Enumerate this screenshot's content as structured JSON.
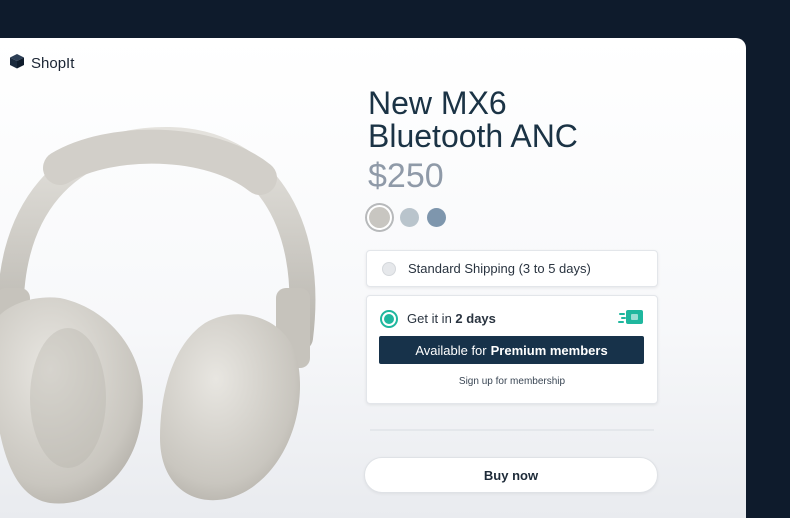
{
  "brand": {
    "name": "ShopIt",
    "icon": "cube-icon"
  },
  "product": {
    "title_line1": "New MX6",
    "title_line2": "Bluetooth ANC",
    "price": "$250",
    "colors": [
      "#c8c6c1",
      "#b9c4cc",
      "#7e96ad"
    ],
    "selected_color": 0
  },
  "shipping": {
    "standard": {
      "label": "Standard Shipping (3 to 5 days)",
      "selected": false
    },
    "express": {
      "label_prefix": "Get it in",
      "label_bold": "2 days",
      "selected": true,
      "icon": "fast-truck-icon",
      "premium_prefix": "Available for",
      "premium_bold": "Premium members",
      "signup_link": "Sign up for membership"
    }
  },
  "cta": {
    "buy_label": "Buy now"
  },
  "theme": {
    "accent": "#1fb79e",
    "dark": "#17324a",
    "page_bg": "#0e1b2c"
  }
}
